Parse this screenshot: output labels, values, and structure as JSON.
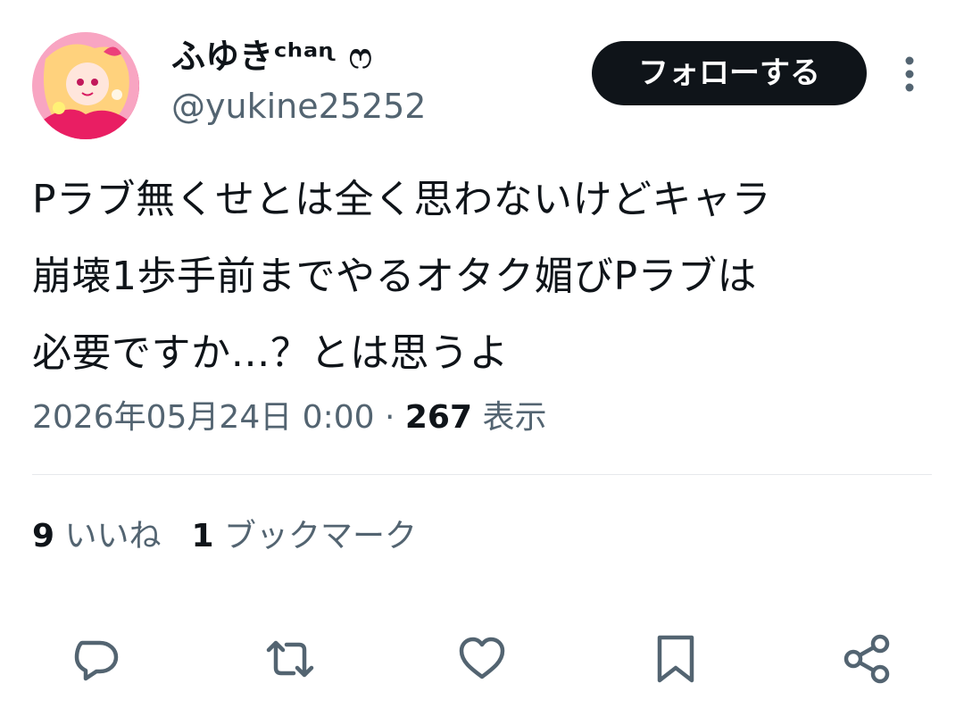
{
  "author": {
    "display_name": "ふゆきᶜʰᵃᶯ ෆ",
    "handle": "@yukine25252"
  },
  "follow_button": {
    "label": "フォローする"
  },
  "tweet": {
    "lines": [
      "Pラブ無くせとは全く思わないけどキャラ",
      "崩壊1歩手前までやるオタク媚びPラブは",
      "必要ですか…？とは思うよ"
    ]
  },
  "meta": {
    "timestamp": "2026年05月24日 0:00",
    "separator": " · ",
    "views_count": "267",
    "views_label": " 表示"
  },
  "stats": {
    "likes_count": "9",
    "likes_label": " いいね",
    "bookmarks_count": "1",
    "bookmarks_label": " ブックマーク"
  },
  "actions": [
    "reply-icon",
    "retweet-icon",
    "like-icon",
    "bookmark-icon",
    "share-icon"
  ],
  "colors": {
    "text_primary": "#0f1419",
    "text_secondary": "#536471",
    "follow_button_bg": "#0f1419",
    "divider": "#e6e9ec",
    "action_icon": "#536471"
  }
}
